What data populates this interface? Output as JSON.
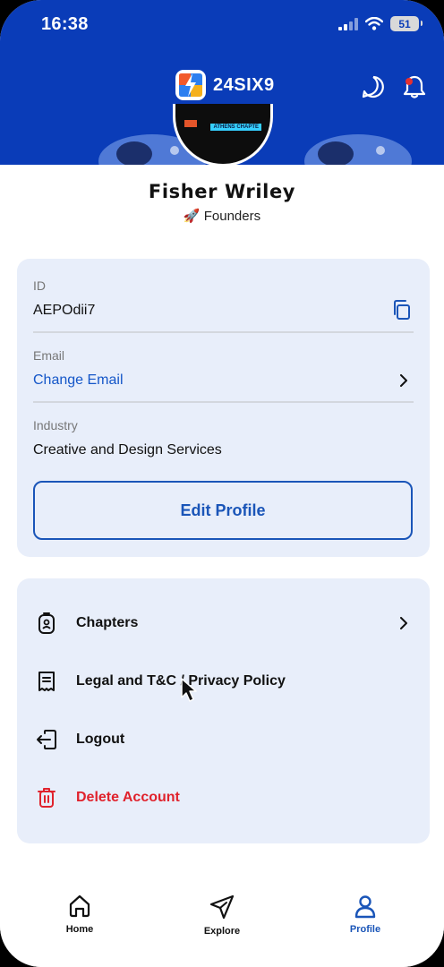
{
  "status_bar": {
    "time": "16:38",
    "battery": "51"
  },
  "brand": {
    "name": "24SIX9"
  },
  "profile": {
    "name": "Fisher Wriley",
    "role_emoji": "🚀",
    "role": "Founders",
    "avatar_tag": "ATHENS CHAPTE"
  },
  "info": {
    "id_label": "ID",
    "id_value": "AEPOdii7",
    "email_label": "Email",
    "email_value": "Change Email",
    "industry_label": "Industry",
    "industry_value": "Creative and Design Services",
    "edit_button": "Edit Profile"
  },
  "menu": {
    "chapters": "Chapters",
    "legal": "Legal and T&C / Privacy Policy",
    "logout": "Logout",
    "delete": "Delete Account"
  },
  "bottom_nav": {
    "home": "Home",
    "explore": "Explore",
    "profile": "Profile",
    "active": "profile"
  },
  "colors": {
    "brand_blue": "#0a3cb8",
    "accent": "#1a55b8",
    "danger": "#e0222c",
    "card": "#e8eefa"
  }
}
